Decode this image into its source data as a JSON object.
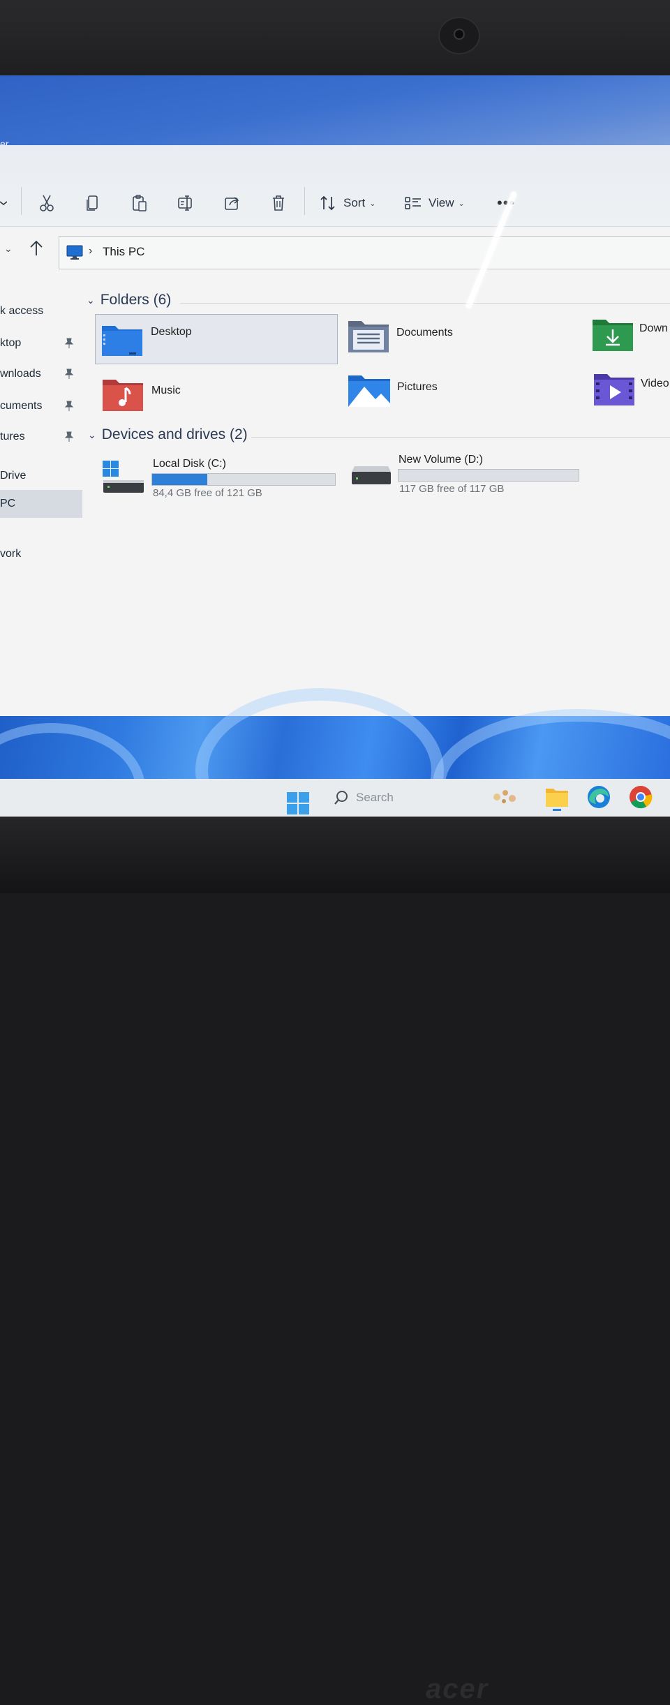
{
  "window": {
    "title": "er"
  },
  "toolbar": {
    "sort_label": "Sort",
    "view_label": "View",
    "more_label": "•••",
    "icons": [
      "scissors-icon",
      "copy-icon",
      "paste-icon",
      "rename-icon",
      "share-icon",
      "delete-icon"
    ]
  },
  "address": {
    "location": "This PC"
  },
  "sidebar": {
    "items": [
      {
        "label": "k access",
        "pinned": false
      },
      {
        "label": "ktop",
        "pinned": true
      },
      {
        "label": "wnloads",
        "pinned": true
      },
      {
        "label": "cuments",
        "pinned": true
      },
      {
        "label": "tures",
        "pinned": true
      },
      {
        "label": "Drive",
        "pinned": false
      },
      {
        "label": "PC",
        "pinned": false,
        "selected": true
      },
      {
        "label": "vork",
        "pinned": false
      }
    ]
  },
  "folders_section": {
    "header": "Folders (6)",
    "items": [
      {
        "label": "Desktop",
        "icon": "desktop-folder-icon"
      },
      {
        "label": "Documents",
        "icon": "documents-folder-icon"
      },
      {
        "label": "Down",
        "icon": "downloads-folder-icon"
      },
      {
        "label": "Music",
        "icon": "music-folder-icon"
      },
      {
        "label": "Pictures",
        "icon": "pictures-folder-icon"
      },
      {
        "label": "Video",
        "icon": "videos-folder-icon"
      }
    ]
  },
  "drives_section": {
    "header": "Devices and drives (2)",
    "drives": [
      {
        "name": "Local Disk (C:)",
        "free_text": "84,4 GB free of 121 GB",
        "used_fraction": 0.3
      },
      {
        "name": "New Volume (D:)",
        "free_text": "117 GB free of 117 GB",
        "used_fraction": 0.0
      }
    ]
  },
  "taskbar": {
    "search_placeholder": "Search",
    "icons": [
      "windows-start-icon",
      "search-icon",
      "widgets-icon",
      "file-explorer-icon",
      "edge-icon",
      "chrome-icon"
    ]
  },
  "colors": {
    "accent": "#2e7fd8",
    "titlebar": "#3b70cf",
    "selection": "#d6dbe2"
  }
}
